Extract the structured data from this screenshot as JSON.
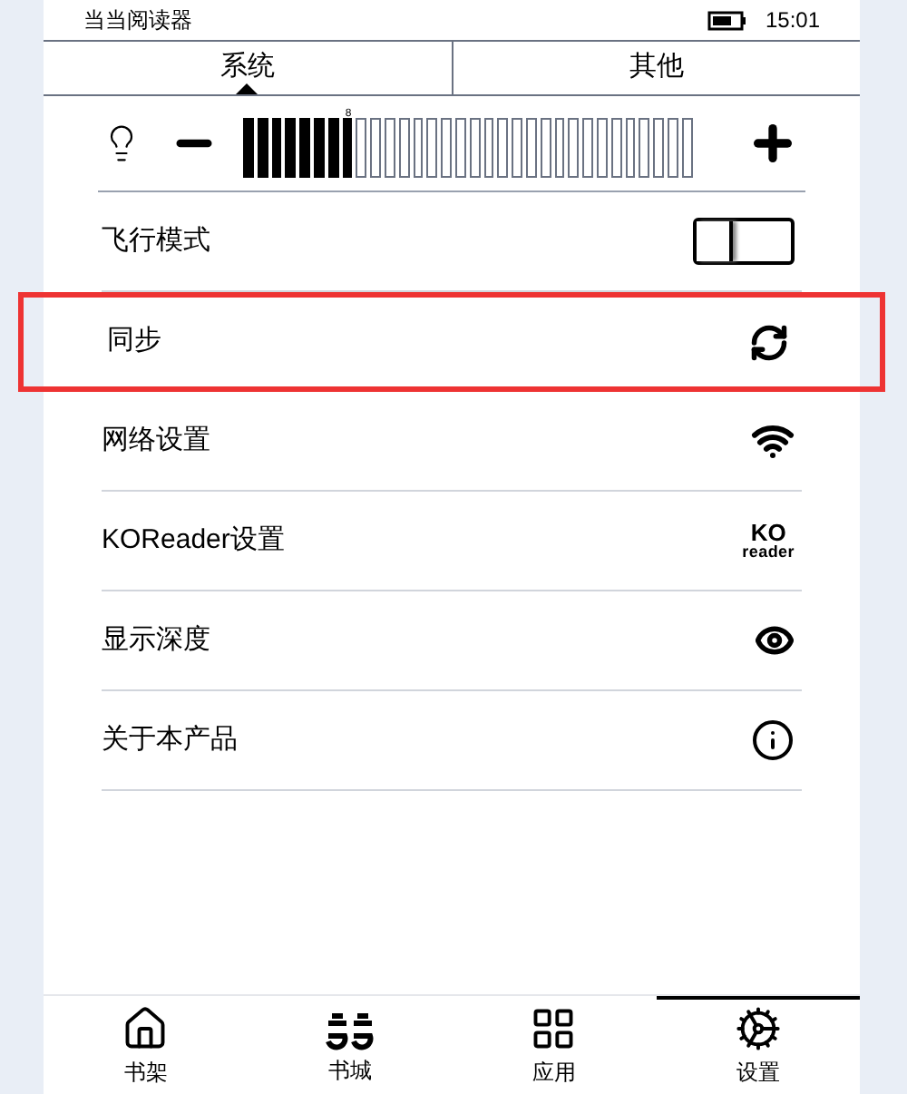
{
  "status_bar": {
    "app_name": "当当阅读器",
    "time": "15:01"
  },
  "tabs": [
    {
      "label": "系统",
      "selected": true
    },
    {
      "label": "其他",
      "selected": false
    }
  ],
  "brightness": {
    "level": 0.25,
    "marker": "8"
  },
  "settings": [
    {
      "label": "飞行模式",
      "kind": "toggle",
      "on": false,
      "highlighted": false
    },
    {
      "label": "同步",
      "kind": "sync",
      "highlighted": true
    },
    {
      "label": "网络设置",
      "kind": "wifi",
      "highlighted": false
    },
    {
      "label": "KOReader设置",
      "kind": "koreader",
      "icon_text": [
        "KO",
        "reader"
      ],
      "highlighted": false
    },
    {
      "label": "显示深度",
      "kind": "eye",
      "highlighted": false
    },
    {
      "label": "关于本产品",
      "kind": "info",
      "highlighted": false
    }
  ],
  "bottom_nav": [
    {
      "label": "书架",
      "kind": "home",
      "selected": false
    },
    {
      "label": "书城",
      "kind": "store",
      "selected": false
    },
    {
      "label": "应用",
      "kind": "apps",
      "selected": false
    },
    {
      "label": "设置",
      "kind": "settings",
      "selected": true
    }
  ]
}
